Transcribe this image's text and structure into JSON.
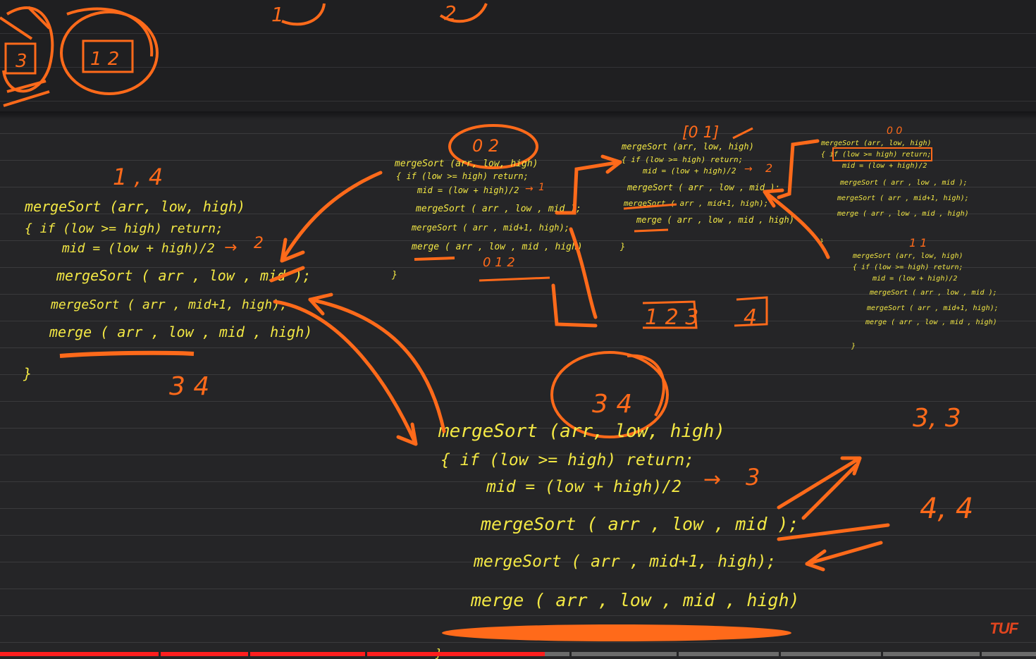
{
  "board": {
    "top": {
      "t1": "1",
      "t2": "2",
      "box3": "3",
      "box12": "1 2"
    },
    "block1": {
      "range": "1 , 4",
      "lines": [
        "mergeSort (arr, low, high)",
        "{  if (low >= high) return;",
        "mid = (low + high)/2",
        "mergeSort ( arr , low , mid );",
        "mergeSort ( arr , mid+1, high);",
        "merge ( arr , low , mid , high)",
        "}"
      ],
      "mid_val": "2",
      "below": "3    4"
    },
    "block2": {
      "range": "0 2",
      "lines": [
        "mergeSort (arr, low, high)",
        "{  if (low >= high) return;",
        "mid = (low + high)/2",
        "mergeSort ( arr , low , mid );",
        "mergeSort ( arr , mid+1, high);",
        "merge ( arr , low , mid , high)",
        "}"
      ],
      "mid_val": "1",
      "below": "0 1 2"
    },
    "block3": {
      "range": "[0 1]",
      "lines": [
        "mergeSort (arr, low, high)",
        "{  if (low >= high) return;",
        "mid = (low + high)/2",
        "mergeSort ( arr , low , mid );",
        "mergeSort ( arr , mid+1, high);",
        "merge ( arr , low , mid , high)",
        "}"
      ],
      "mid_val": "2",
      "below": "1 2 3",
      "below2": "4"
    },
    "block4": {
      "range": "0 0",
      "lines": [
        "mergeSort (arr, low, high)",
        "{  if (low >= high) return;",
        "mid = (low + high)/2",
        "mergeSort ( arr , low , mid );",
        "mergeSort ( arr , mid+1, high);",
        "merge ( arr , low , mid , high)",
        "}"
      ]
    },
    "block5": {
      "range": "1 1",
      "lines": [
        "mergeSort (arr, low, high)",
        "{  if (low >= high) return;",
        "mid = (low + high)/2",
        "mergeSort ( arr , low , mid );",
        "mergeSort ( arr , mid+1, high);",
        "merge ( arr , low , mid , high)",
        "}"
      ]
    },
    "block6": {
      "range": "3 4",
      "lines": [
        "mergeSort (arr, low, high)",
        "{  if (low >= high) return;",
        "mid = (low + high)/2",
        "mergeSort ( arr , low , mid );",
        "mergeSort ( arr , mid+1, high);",
        "merge ( arr , low , mid , high)",
        "}"
      ],
      "mid_val": "3",
      "right1": "3, 3",
      "right2": "4, 4"
    }
  },
  "brand": "TUF",
  "player": {
    "progress_percent": 52.6
  },
  "colors": {
    "code": "#f3e844",
    "ink": "#ff6a1a",
    "progress": "#ff1e1e"
  }
}
